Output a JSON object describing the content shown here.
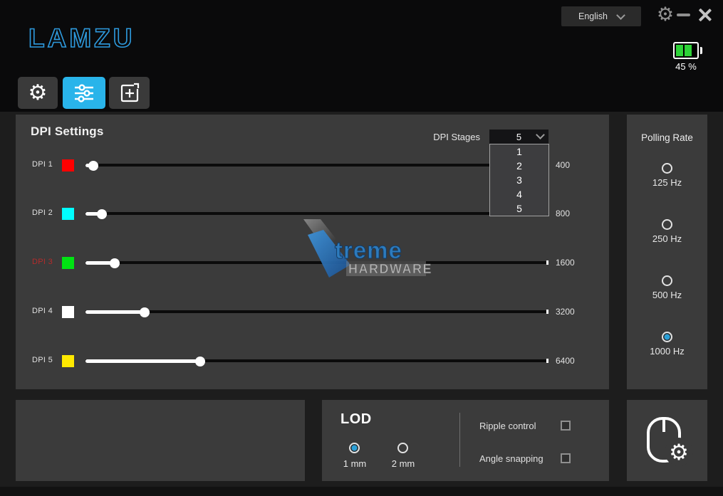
{
  "brand": {
    "logo_text": "LAMZU"
  },
  "titlebar": {
    "language_selector": {
      "value": "English"
    }
  },
  "battery": {
    "percent": "45 %",
    "bars": 2
  },
  "glyphs": {
    "gear": "⚙"
  },
  "icons": {
    "titlebar_settings": "gear-icon",
    "titlebar_minimize": "minimize-icon",
    "titlebar_close": "close-icon",
    "language_dropdown": "chevron-down-icon",
    "stages_dropdown": "chevron-down-icon",
    "battery": "battery-icon",
    "tab_settings": "gear-icon",
    "tab_dpi": "sliders-icon",
    "tab_add": "plus-box-icon",
    "mouse_settings": "mouse-gear-icon"
  },
  "tabs": [
    {
      "name": "settings",
      "active": false
    },
    {
      "name": "dpi",
      "active": true
    },
    {
      "name": "add-profile",
      "active": false
    }
  ],
  "dpi_panel": {
    "title": "DPI Settings",
    "stages_label": "DPI Stages",
    "stages_value": "5",
    "stages_options": [
      "1",
      "2",
      "3",
      "4",
      "5"
    ],
    "rows": [
      {
        "label": "DPI 1",
        "color": "#ff0000",
        "value": "400",
        "pct": 1.7,
        "active": false
      },
      {
        "label": "DPI 2",
        "color": "#00ffff",
        "value": "800",
        "pct": 3.5,
        "active": false
      },
      {
        "label": "DPI 3",
        "color": "#00e312",
        "value": "1600",
        "pct": 6.3,
        "active": true
      },
      {
        "label": "DPI 4",
        "color": "#ffffff",
        "value": "3200",
        "pct": 12.8,
        "active": false
      },
      {
        "label": "DPI 5",
        "color": "#ffe900",
        "value": "6400",
        "pct": 24.9,
        "active": false
      }
    ]
  },
  "polling_panel": {
    "title": "Polling Rate",
    "options": [
      {
        "label": "125 Hz",
        "selected": false
      },
      {
        "label": "250 Hz",
        "selected": false
      },
      {
        "label": "500 Hz",
        "selected": false
      },
      {
        "label": "1000 Hz",
        "selected": true
      }
    ]
  },
  "lod_panel": {
    "title": "LOD",
    "options": [
      {
        "label": "1 mm",
        "selected": true
      },
      {
        "label": "2 mm",
        "selected": false
      }
    ],
    "toggles": [
      {
        "label": "Ripple control",
        "checked": false
      },
      {
        "label": "Angle snapping",
        "checked": false
      }
    ]
  },
  "watermark": {
    "text": "treme",
    "subtext": "HARDWARE"
  },
  "colors": {
    "accent_blue": "#29b4ea",
    "radio_blue": "#2aa0d8",
    "active_dpi_red": "#b42b2b",
    "battery_green": "#2ed338",
    "logo_blue": "#2e9bdf"
  }
}
